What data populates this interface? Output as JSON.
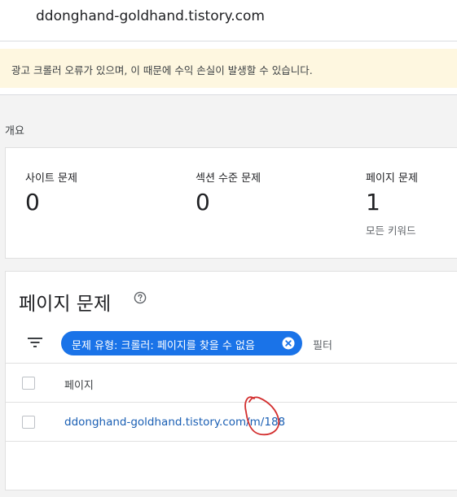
{
  "header": {
    "site_title": "ddonghand-goldhand.tistory.com"
  },
  "warning": {
    "text": "광고 크롤러 오류가 있으며, 이 때문에 수익 손실이 발생할 수 있습니다."
  },
  "overview": {
    "label": "개요",
    "metrics": [
      {
        "label": "사이트 문제",
        "value": "0",
        "sub": ""
      },
      {
        "label": "섹션 수준 문제",
        "value": "0",
        "sub": ""
      },
      {
        "label": "페이지 문제",
        "value": "1",
        "sub": "모든 키워드"
      }
    ]
  },
  "page_issues": {
    "title": "페이지 문제",
    "help_icon": "help-circle-icon",
    "filter_icon": "filter-list-icon",
    "chip_label": "문제 유형: 크롤러: 페이지를 찾을 수 없음",
    "chip_close_icon": "close-circle-icon",
    "filter_label": "필터",
    "table": {
      "column_header": "페이지",
      "rows": [
        {
          "url": "ddonghand-goldhand.tistory.com/m/188"
        }
      ]
    }
  },
  "colors": {
    "accent": "#1a73e8",
    "link": "#1a5fb4",
    "warning_bg": "#fef7e0",
    "annotation": "#d32f2f"
  }
}
